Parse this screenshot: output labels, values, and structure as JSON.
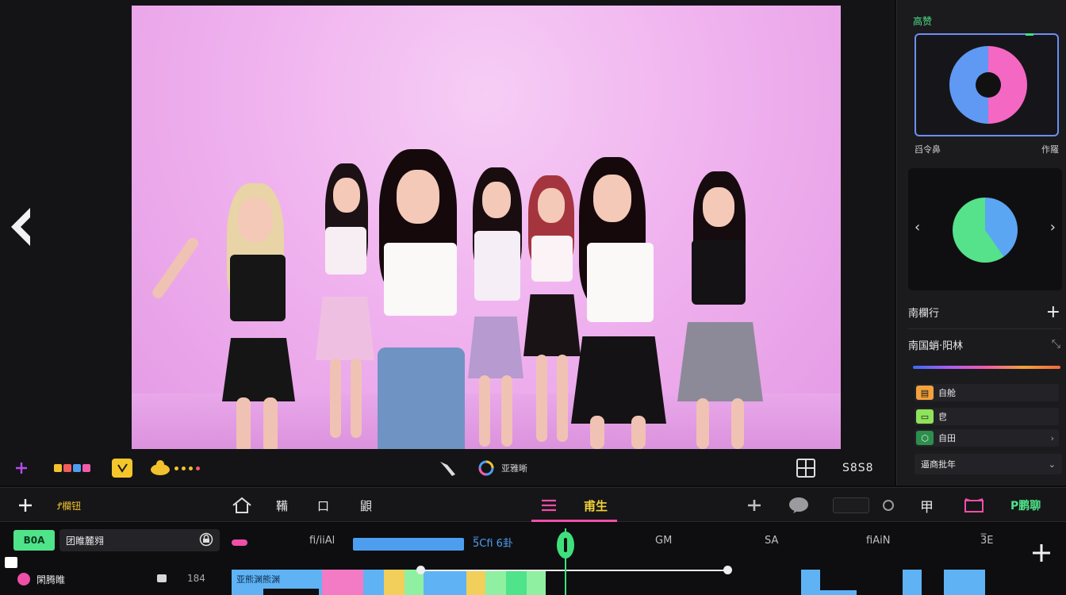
{
  "preview": {
    "nav_prev_icon": "chevron-left-icon",
    "toolbar": {
      "add_icon": "plus-icon",
      "color_swatches": [
        "#f2c12e",
        "#f25c5c",
        "#4e9ef0",
        "#f25ca6"
      ],
      "sticker_icon": "sticker-icon",
      "effects_icon": "effects-icon",
      "brush_icon": "brush-icon",
      "filter_icon": "filter-icon",
      "filter_label": "亚雅晰",
      "grid_icon": "grid-icon",
      "ratio_label": "S8S8"
    }
  },
  "right_panel": {
    "color_title": "高赞",
    "color_caption_left": "舀令鼻",
    "color_caption_right": "作羅",
    "color_wheel_colors": [
      "#f467c2",
      "#5f99f4"
    ],
    "pie_colors": [
      "#5ba6f2",
      "#55e28a"
    ],
    "section1_label": "南欄行",
    "section2_label": "南国蛸·阳林",
    "layers": [
      {
        "label": "自舱",
        "color": "#f2a13c"
      },
      {
        "label": "皀",
        "color": "#8ee35a"
      },
      {
        "label": "自田",
        "color": "#3fbf6a"
      }
    ],
    "dropdown_label": "逼商批年"
  },
  "main_toolbar": {
    "add_icon": "plus-icon",
    "project_label": "Ꝭ欄钮",
    "home_icon": "home-icon",
    "tool1_label": "鞴",
    "tool2_label": "口",
    "tool3_label": "鼰",
    "menu_icon": "menu-icon",
    "active_tab_label": "甫生",
    "audio_icon": "audio-icon",
    "comment_icon": "comment-icon",
    "record_icon": "record-icon",
    "split_label": "甲",
    "crop_icon": "crop-icon",
    "export_label": "P鹏聊",
    "accent": "#ef4fa8",
    "export_color": "#4fe38a"
  },
  "timeline": {
    "track_name": "B0A",
    "track_field": "团睢麓翙",
    "track_field_icon": "lock-icon",
    "row_label": "閑腾睢",
    "row_value": "184",
    "ruler_labels": [
      "fi/iiAl",
      "5̅Cfi 6卦",
      "GM",
      "SA",
      "fiAiN",
      "3̅E"
    ],
    "add_track_icon": "plus-icon",
    "clip_text": "亚熊渊熊渊"
  }
}
